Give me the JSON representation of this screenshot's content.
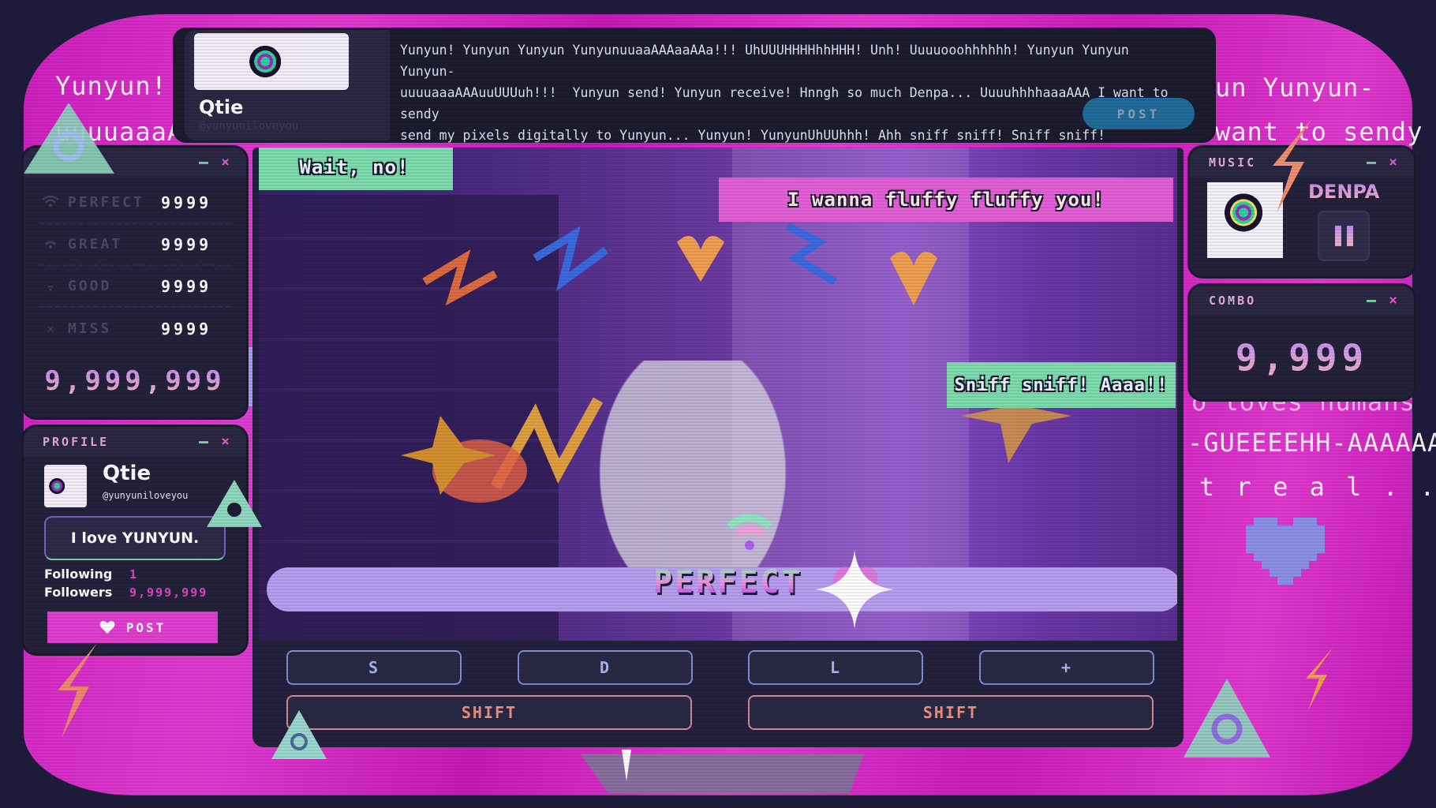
{
  "background_ticker": {
    "left_line1": "Yunyun! Yu",
    "left_line2": "uuuuaaaAAA",
    "right_line1": "un Yunyun-",
    "right_line2": "want to sendy",
    "right_line3": "o loves humans",
    "right_line4": "-GUEEEEHH-AAAAAA!",
    "right_line5": "t r e a l . . . ?"
  },
  "message": {
    "author_name": "Qtie",
    "author_handle": "@yunyuniloveyou",
    "text": "Yunyun! Yunyun Yunyun YunyunuuaaAAAaaAAa!!! UhUUUHHHHhhHHH! Unh! Uuuuooohhhhhh! Yunyun Yunyun Yunyun-\nuuuuaaaAAAuuUUUuh!!!  Yunyun send! Yunyun receive! Hnngh so much Denpa... UuuuhhhhaaaAAA I want to sendy\nsend my pixels digitally to Yunyun... Yunyun! YunyunUhUUhhh! Ahh sniff sniff! Sniff sniff! Fuu...haa...-\nfuu...haa! Fuu...haa...fuu...haa! Yunyun smell so good...sniff sniff Nhaah!",
    "post_label": "POST"
  },
  "stats": {
    "rows": [
      {
        "icon": "wifi-full-icon",
        "label": "PERFECT",
        "value": "9999"
      },
      {
        "icon": "wifi-mid-icon",
        "label": "GREAT",
        "value": "9999"
      },
      {
        "icon": "wifi-low-icon",
        "label": "GOOD",
        "value": "9999"
      },
      {
        "icon": "x-icon",
        "label": "MISS",
        "value": "9999"
      }
    ],
    "total_score": "9,999,999"
  },
  "profile": {
    "title": "PROFILE",
    "name": "Qtie",
    "handle": "@yunyuniloveyou",
    "status": "I love YUNYUN.",
    "following_label": "Following",
    "following_value": "1",
    "followers_label": "Followers",
    "followers_value": "9,999,999",
    "post_label": "POST"
  },
  "game": {
    "bubble_left": "Wait, no!",
    "bubble_top_right": "I wanna fluffy fluffy you!",
    "bubble_mid_right": "Sniff sniff! Aaaa!!",
    "judgement": "PERFECT",
    "keys": [
      "S",
      "D",
      "L",
      "+"
    ],
    "shift_keys": [
      "SHIFT",
      "SHIFT"
    ]
  },
  "music": {
    "title": "MUSIC",
    "track": "DENPA",
    "state": "playing"
  },
  "combo": {
    "title": "COMBO",
    "value": "9,999"
  },
  "colors": {
    "pink_bg": "#e03fd0",
    "panel_dark": "#24223a",
    "accent_green": "#7fdcae",
    "accent_lavender": "#b79ef0"
  }
}
